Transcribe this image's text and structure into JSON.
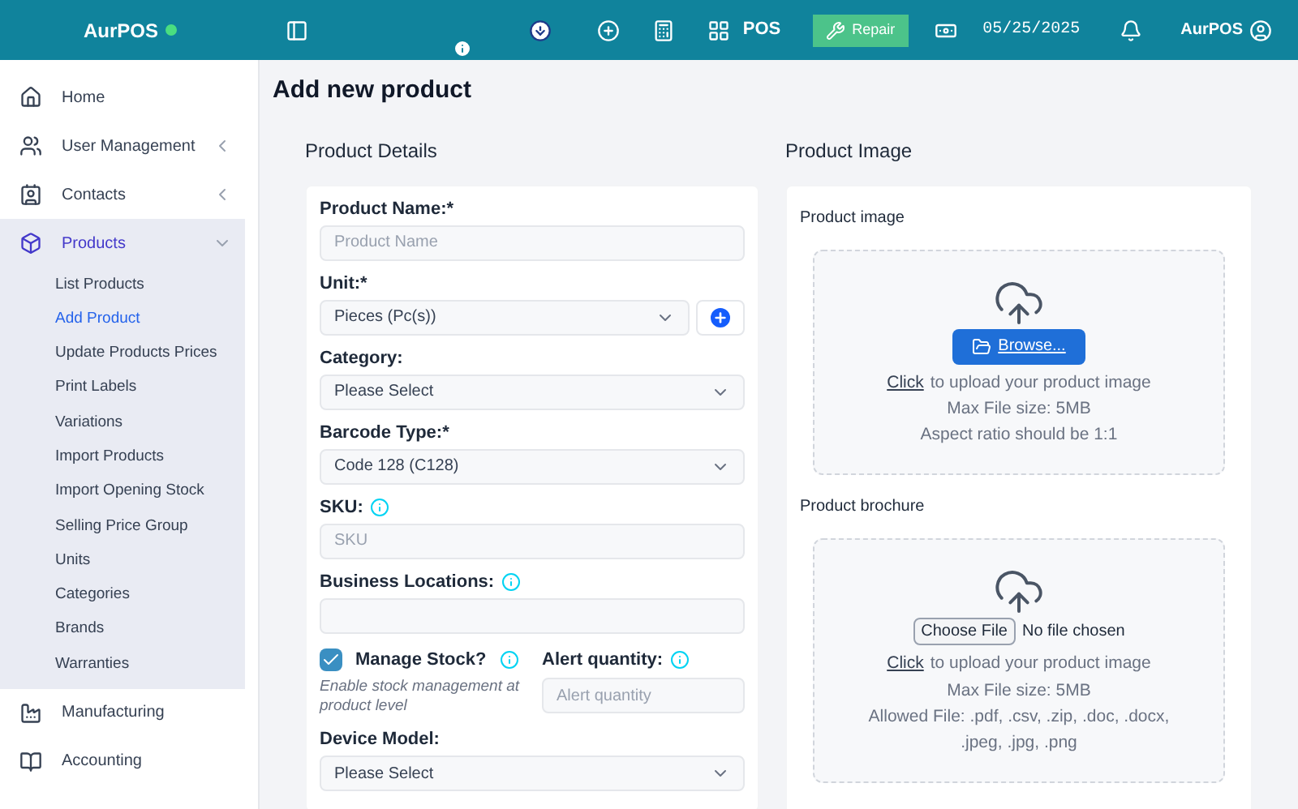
{
  "topbar": {
    "logo": "AurPOS",
    "pos_label": "POS",
    "repair_button": "Repair",
    "date": "05/25/2025",
    "user": "AurPOS"
  },
  "sidebar": {
    "items": [
      {
        "label": "Home",
        "selected": false,
        "has_caret": false
      },
      {
        "label": "User Management",
        "expanded": false,
        "selected": false,
        "has_caret": true
      },
      {
        "label": "Contacts",
        "expanded": false,
        "selected": false,
        "has_caret": true
      },
      {
        "label": "Products",
        "expanded": true,
        "selected": true,
        "has_caret": true,
        "children": [
          {
            "label": "List Products",
            "selected": false
          },
          {
            "label": "Add Product",
            "selected": true
          },
          {
            "label": "Update Products Prices",
            "selected": false
          },
          {
            "label": "Print Labels",
            "selected": false
          },
          {
            "label": "Variations",
            "selected": false
          },
          {
            "label": "Import Products",
            "selected": false
          },
          {
            "label": "Import Opening Stock",
            "selected": false
          },
          {
            "label": "Selling Price Group",
            "selected": false
          },
          {
            "label": "Units",
            "selected": false
          },
          {
            "label": "Categories",
            "selected": false
          },
          {
            "label": "Brands",
            "selected": false
          },
          {
            "label": "Warranties",
            "selected": false
          }
        ]
      },
      {
        "label": "Manufacturing",
        "selected": false,
        "has_caret": false
      },
      {
        "label": "Accounting",
        "selected": false,
        "has_caret": false
      }
    ]
  },
  "page_title": "Add new product",
  "details": {
    "title": "Product Details",
    "fields": [
      {
        "kind": "text",
        "label": "Product Name:*",
        "info": false,
        "placeholder": "Product Name"
      },
      {
        "kind": "select_add",
        "label": "Unit:*",
        "value": "Pieces (Pc(s))"
      },
      {
        "kind": "select",
        "label": "Category:",
        "value": "Please Select"
      },
      {
        "kind": "select",
        "label": "Barcode Type:*",
        "value": "Code 128 (C128)"
      },
      {
        "kind": "text",
        "label": "SKU:",
        "info": true,
        "placeholder": "SKU"
      },
      {
        "kind": "text",
        "label": "Business Locations:",
        "info": true
      },
      {
        "kind": "stock",
        "label": "Manage Stock?",
        "checked": true,
        "help": "Enable stock management at product level",
        "alert_label": "Alert quantity:",
        "alert_placeholder": "Alert quantity"
      },
      {
        "kind": "select",
        "label": "Device Model:",
        "value": "Please Select"
      }
    ]
  },
  "image": {
    "title": "Product Image",
    "uploads": [
      {
        "kind": "browse",
        "label": "Product image",
        "button": "Browse...",
        "click": "Click",
        "text": "to upload your product image",
        "lines": [
          "Max File size: 5MB",
          "Aspect ratio should be 1:1"
        ]
      },
      {
        "kind": "file",
        "label": "Product brochure",
        "button": "Choose File",
        "status": "No file chosen",
        "click": "Click",
        "text": "to upload your product image",
        "lines": [
          "Max File size: 5MB",
          "Allowed File: .pdf, .csv, .zip, .doc, .docx, .jpeg, .jpg, .png"
        ]
      }
    ]
  }
}
